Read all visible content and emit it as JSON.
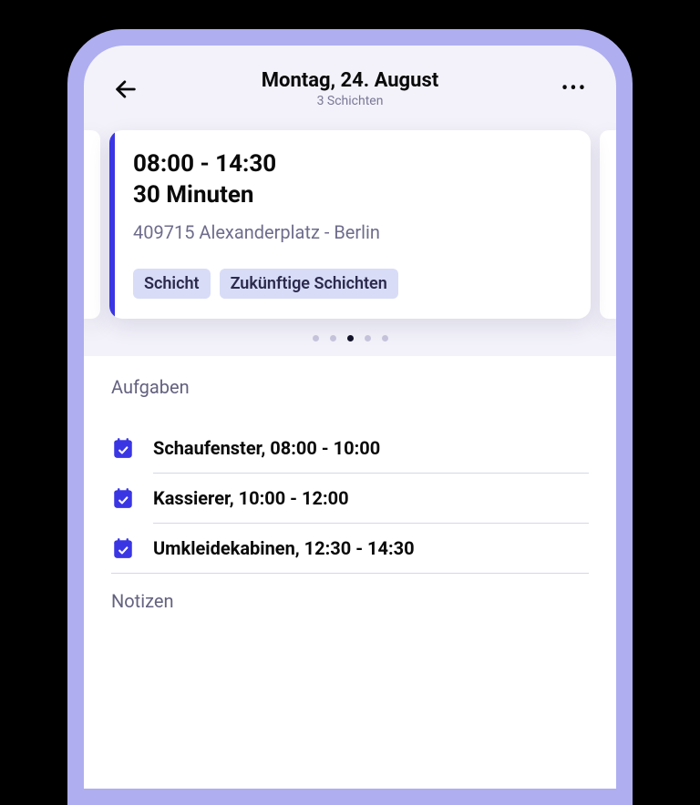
{
  "header": {
    "title": "Montag, 24. August",
    "subtitle": "3 Schichten"
  },
  "card": {
    "time_range": "08:00 - 14:30",
    "duration": "30 Minuten",
    "location": "409715 Alexanderplatz - Berlin",
    "tags": [
      "Schicht",
      "Zukünftige Schichten"
    ]
  },
  "carousel": {
    "count": 5,
    "active_index": 2
  },
  "sections": {
    "tasks_title": "Aufgaben",
    "notes_title": "Notizen"
  },
  "tasks": [
    {
      "label": "Schaufenster, 08:00 - 10:00"
    },
    {
      "label": "Kassierer, 10:00 - 12:00"
    },
    {
      "label": "Umkleidekabinen, 12:30 - 14:30"
    }
  ],
  "colors": {
    "accent": "#3A36E4",
    "tag_bg": "#D8DCF7"
  }
}
